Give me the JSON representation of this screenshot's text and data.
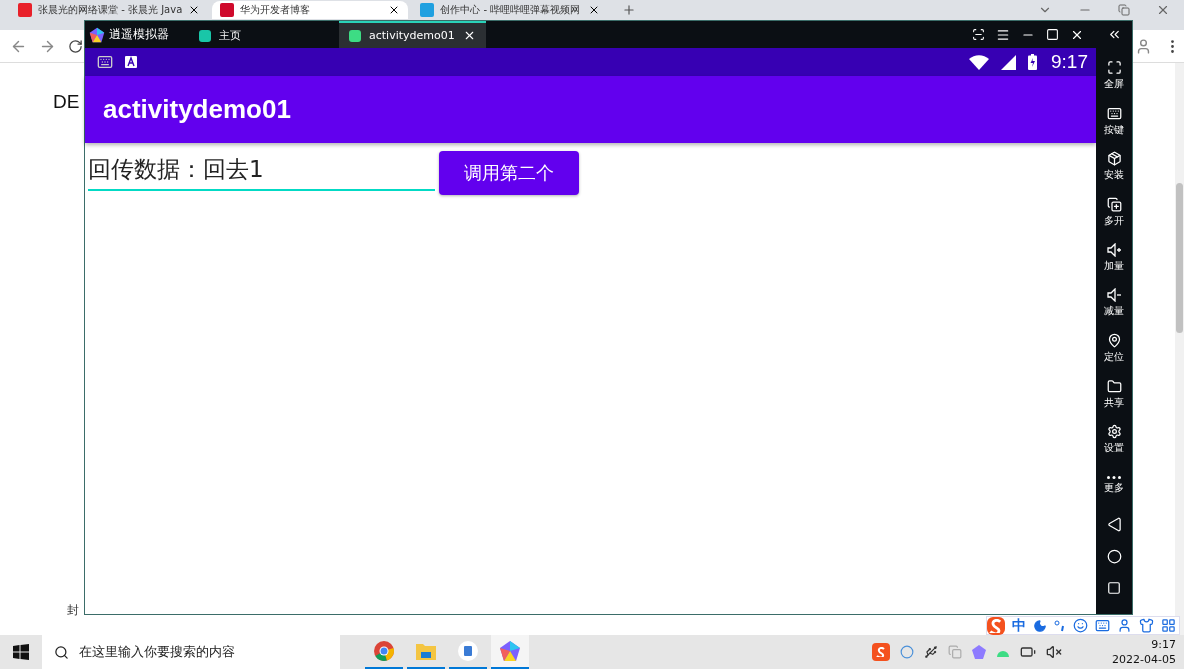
{
  "browser": {
    "tabs": [
      {
        "title": "张晨光的网络课堂 - 张晨光 Java",
        "selected": false
      },
      {
        "title": "华为开发者博客",
        "selected": true
      },
      {
        "title": "创作中心 - 哔哩哔哩弹幕视频网",
        "selected": false
      }
    ],
    "page_heading": "DE",
    "page_fragment": "封"
  },
  "emulator": {
    "title": "逍遥模拟器",
    "tabs": [
      {
        "label": "主页",
        "selected": false
      },
      {
        "label": "activitydemo01",
        "selected": true
      }
    ],
    "status_bar": {
      "time": "9:17"
    },
    "app_bar": {
      "title": "activitydemo01"
    },
    "edit_text": {
      "value": "回传数据：回去1"
    },
    "button": {
      "label": "调用第二个"
    },
    "sidebar": [
      {
        "label": "全屏"
      },
      {
        "label": "按键"
      },
      {
        "label": "安装"
      },
      {
        "label": "多开"
      },
      {
        "label": "加量"
      },
      {
        "label": "减量"
      },
      {
        "label": "定位"
      },
      {
        "label": "共享"
      },
      {
        "label": "设置"
      },
      {
        "label": "更多"
      }
    ]
  },
  "ime_bar": {
    "mode": "中"
  },
  "taskbar": {
    "search": {
      "placeholder": "在这里输入你要搜索的内容"
    },
    "time": "9:17",
    "date": "2022-04-05"
  }
}
